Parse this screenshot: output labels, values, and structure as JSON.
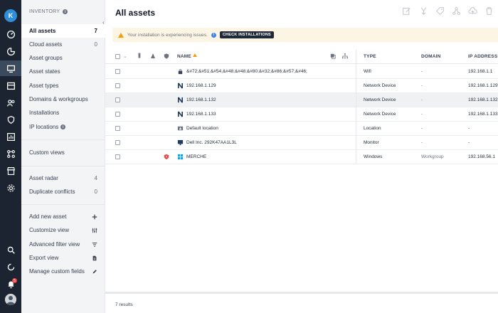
{
  "rail": {
    "avatar_letter": "K",
    "bell_count": "5",
    "icons": [
      "dashboard-icon",
      "reports-icon",
      "assets-icon",
      "calendar-icon",
      "users-icon",
      "security-icon",
      "analytics-icon",
      "integrations-icon",
      "store-icon",
      "settings-icon"
    ],
    "bottom_icons": [
      "search-icon",
      "refresh-icon",
      "notifications-icon"
    ]
  },
  "sidebar": {
    "header": "INVENTORY",
    "items": [
      {
        "label": "All assets",
        "count": "7"
      },
      {
        "label": "Cloud assets",
        "count": "0"
      },
      {
        "label": "Asset groups",
        "count": ""
      },
      {
        "label": "Asset states",
        "count": ""
      },
      {
        "label": "Asset types",
        "count": ""
      },
      {
        "label": "Domains & workgroups",
        "count": ""
      },
      {
        "label": "Installations",
        "count": ""
      },
      {
        "label": "IP locations",
        "count": ""
      }
    ],
    "custom_views": "Custom views",
    "extra": [
      {
        "label": "Asset radar",
        "count": "4"
      },
      {
        "label": "Duplicate conflicts",
        "count": "0"
      }
    ],
    "actions": [
      {
        "label": "Add new asset",
        "icon": "plus-icon"
      },
      {
        "label": "Customize view",
        "icon": "sliders-icon"
      },
      {
        "label": "Advanced filter view",
        "icon": "filter-icon"
      },
      {
        "label": "Export view",
        "icon": "export-icon"
      },
      {
        "label": "Manage custom fields",
        "icon": "pencil-icon"
      }
    ]
  },
  "header": {
    "title": "All assets",
    "toolbar": [
      "edit-icon",
      "merge-icon",
      "tag-icon",
      "group-icon",
      "upload-icon",
      "delete-icon"
    ]
  },
  "banner": {
    "message": "Your installation is experiencing issues.",
    "button": "CHECK INSTALLATIONS"
  },
  "table": {
    "columns": {
      "name": "NAME",
      "type": "TYPE",
      "domain": "DOMAIN",
      "ip": "IP ADDRESS"
    },
    "rows": [
      {
        "name": "&#72;&#51;&#54;&#48;&#48;&#80;&#32;&#86;&#57;&#46;",
        "type": "Wifi",
        "domain": "-",
        "ip": "192.168.1.1",
        "icon": "wifi-device-icon",
        "alert": false,
        "highlight": false
      },
      {
        "name": "192.168.1.129",
        "type": "Network Device",
        "domain": "-",
        "ip": "192.168.1.129",
        "icon": "network-device-icon",
        "alert": false,
        "highlight": false
      },
      {
        "name": "192.168.1.132",
        "type": "Network Device",
        "domain": "-",
        "ip": "192.168.1.132",
        "icon": "network-device-icon",
        "alert": false,
        "highlight": true
      },
      {
        "name": "192.168.1.133",
        "type": "Network Device",
        "domain": "-",
        "ip": "192.168.1.133",
        "icon": "network-device-icon",
        "alert": false,
        "highlight": false
      },
      {
        "name": "Default location",
        "type": "Location",
        "domain": "-",
        "ip": "-",
        "icon": "location-icon",
        "alert": false,
        "highlight": false
      },
      {
        "name": "Dell Inc. 292K47AA1L3L",
        "type": "Monitor",
        "domain": "-",
        "ip": "-",
        "icon": "monitor-icon",
        "alert": false,
        "highlight": false
      },
      {
        "name": "MERCHE",
        "type": "Windows",
        "domain": "Workgroup",
        "ip": "192.168.56.1",
        "icon": "windows-icon",
        "alert": true,
        "highlight": false
      }
    ]
  },
  "footer": {
    "results": "7 results"
  },
  "colors": {
    "rail": "#1b2430",
    "accent": "#f59e0b",
    "alert": "#ef4444"
  }
}
